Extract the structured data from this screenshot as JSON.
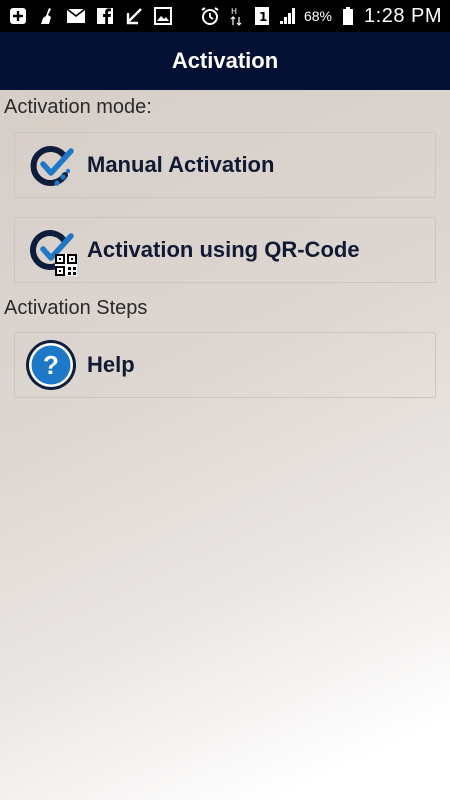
{
  "status_bar": {
    "battery": "68%",
    "time": "1:28 PM",
    "icons": [
      "add-box-icon",
      "broom-icon",
      "mail-icon",
      "facebook-icon",
      "download-arrow-icon",
      "image-icon",
      "alarm-icon",
      "data-arrows-icon",
      "sim-1-icon",
      "signal-icon",
      "battery-icon"
    ]
  },
  "app_bar": {
    "title": "Activation"
  },
  "sections": {
    "mode_label": "Activation mode:",
    "steps_label": "Activation Steps"
  },
  "options": {
    "manual": "Manual Activation",
    "qr": "Activation using QR-Code",
    "help": "Help"
  },
  "colors": {
    "app_bar": "#041135",
    "accent_blue": "#1e78c8",
    "icon_dark": "#0f1d3c"
  }
}
